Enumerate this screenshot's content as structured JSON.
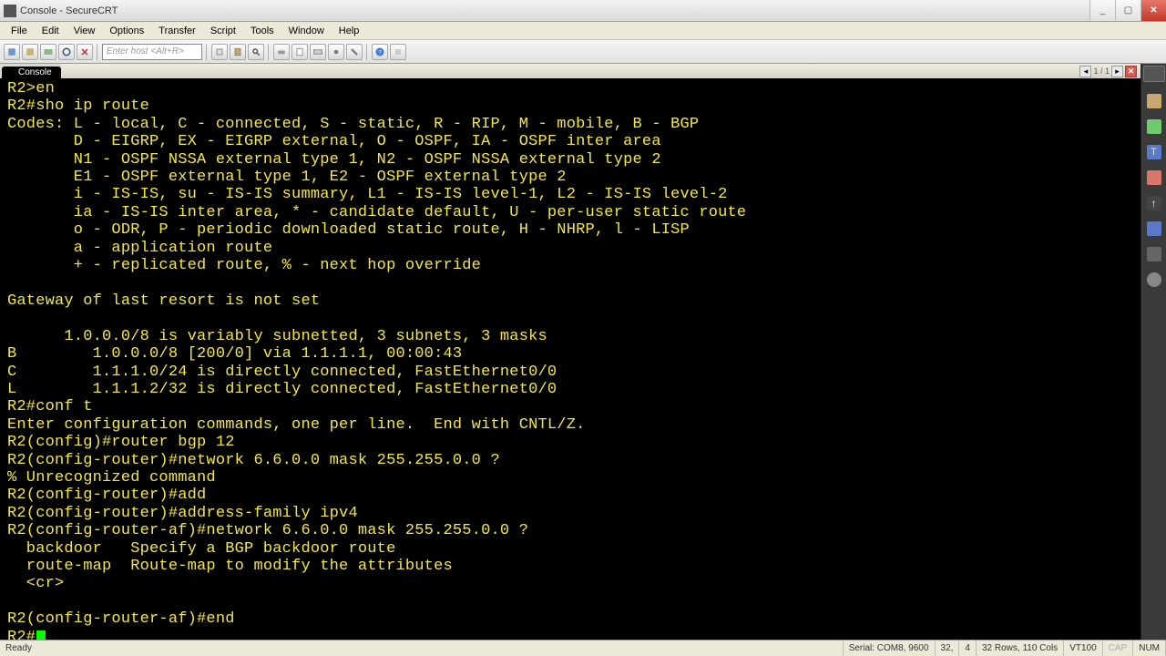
{
  "window": {
    "title": "Console - SecureCRT",
    "min": "_",
    "max": "▢",
    "close": "✕"
  },
  "menu": {
    "file": "File",
    "edit": "Edit",
    "view": "View",
    "options": "Options",
    "transfer": "Transfer",
    "script": "Script",
    "tools": "Tools",
    "window": "Window",
    "help": "Help"
  },
  "toolbar": {
    "host_placeholder": "Enter host <Alt+R>"
  },
  "tab": {
    "label": "Console",
    "counter": "1 / 1"
  },
  "terminal_lines": [
    "R2>en",
    "R2#sho ip route",
    "Codes: L - local, C - connected, S - static, R - RIP, M - mobile, B - BGP",
    "       D - EIGRP, EX - EIGRP external, O - OSPF, IA - OSPF inter area",
    "       N1 - OSPF NSSA external type 1, N2 - OSPF NSSA external type 2",
    "       E1 - OSPF external type 1, E2 - OSPF external type 2",
    "       i - IS-IS, su - IS-IS summary, L1 - IS-IS level-1, L2 - IS-IS level-2",
    "       ia - IS-IS inter area, * - candidate default, U - per-user static route",
    "       o - ODR, P - periodic downloaded static route, H - NHRP, l - LISP",
    "       a - application route",
    "       + - replicated route, % - next hop override",
    "",
    "Gateway of last resort is not set",
    "",
    "      1.0.0.0/8 is variably subnetted, 3 subnets, 3 masks",
    "B        1.0.0.0/8 [200/0] via 1.1.1.1, 00:00:43",
    "C        1.1.1.0/24 is directly connected, FastEthernet0/0",
    "L        1.1.1.2/32 is directly connected, FastEthernet0/0",
    "R2#conf t",
    "Enter configuration commands, one per line.  End with CNTL/Z.",
    "R2(config)#router bgp 12",
    "R2(config-router)#network 6.6.0.0 mask 255.255.0.0 ?",
    "% Unrecognized command",
    "R2(config-router)#add",
    "R2(config-router)#address-family ipv4",
    "R2(config-router-af)#network 6.6.0.0 mask 255.255.0.0 ?",
    "  backdoor   Specify a BGP backdoor route",
    "  route-map  Route-map to modify the attributes",
    "  <cr>",
    "",
    "R2(config-router-af)#end"
  ],
  "terminal_prompt": "R2#",
  "status": {
    "ready": "Ready",
    "serial": "Serial: COM8, 9600",
    "row": "32,",
    "col": "4",
    "rows": "32 Rows, 110 Cols",
    "term": "VT100",
    "caps": "CAP",
    "num": "NUM"
  }
}
